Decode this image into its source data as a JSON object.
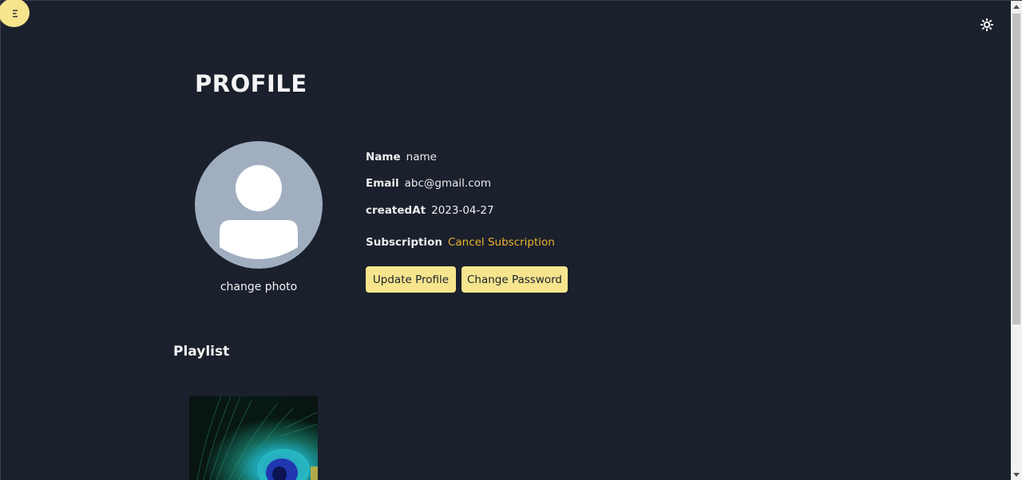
{
  "header": {
    "menu_icon": "menu-icon",
    "theme_icon": "sun-icon"
  },
  "profile": {
    "title": "PROFILE",
    "avatar_icon": "user-avatar-icon",
    "change_photo_label": "change photo",
    "name_label": "Name",
    "name_value": "name",
    "email_label": "Email",
    "email_value": "abc@gmail.com",
    "created_label": "createdAt",
    "created_value": "2023-04-27",
    "subscription_label": "Subscription",
    "subscription_action": "Cancel Subscription",
    "update_button": "Update Profile",
    "password_button": "Change Password"
  },
  "playlist": {
    "title": "Playlist"
  },
  "colors": {
    "background": "#1a202c",
    "accent": "#f6e58d",
    "link": "#ecb22e",
    "avatar_bg": "#a0aec0"
  }
}
